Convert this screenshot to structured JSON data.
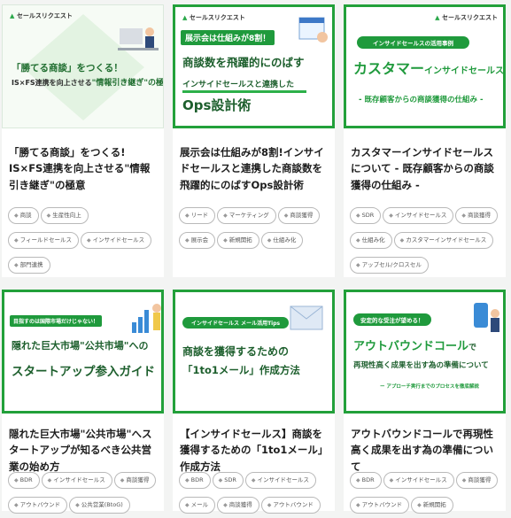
{
  "brand": "セールスリクエスト",
  "cards": [
    {
      "thumb": {
        "line1": "「勝てる商談」をつくる！",
        "line2": "IS×FS連携を向上させる",
        "line3": "\"情報引き継ぎ\"の極意"
      },
      "title": "「勝てる商談」をつくる! IS×FS連携を向上させる\"情報引き継ぎ\"の極意",
      "tags": [
        "商談",
        "生産性向上",
        "フィールドセールス",
        "インサイドセールス",
        "部門連携"
      ]
    },
    {
      "thumb": {
        "pill": "展示会は仕組みが8割！",
        "line1": "商談数を飛躍的にのばす",
        "line2": "インサイドセールスと連携した",
        "line3": "Ops設計術"
      },
      "title": "展示会は仕組みが8割!インサイドセールスと連携した商談数を飛躍的にのばすOps設計術",
      "tags": [
        "リード",
        "マーケティング",
        "商談獲得",
        "展示会",
        "新規開拓",
        "仕組み化"
      ]
    },
    {
      "thumb": {
        "pill": "インサイドセールスの活用事例",
        "line1": "カスタマー",
        "line1b": "インサイドセールス",
        "line2": "- 既存顧客からの商談獲得の仕組み -"
      },
      "title": "カスタマーインサイドセールスについて - 既存顧客からの商談獲得の仕組み -",
      "tags": [
        "SDR",
        "インサイドセールス",
        "商談獲得",
        "仕組み化",
        "カスタマーインサイドセールス",
        "アップセル/クロスセル"
      ]
    },
    {
      "thumb": {
        "pill": "目指すのは国際市場だけじゃない！",
        "line1": "隠れた巨大市場\"公共市場\"への",
        "line2": "スタートアップ参入ガイド"
      },
      "title": "隠れた巨大市場\"公共市場\"へスタートアップが知るべき公共営業の始め方",
      "tags": [
        "BDR",
        "インサイドセールス",
        "商談獲得",
        "アウトバウンド",
        "公共営業(BtoG)"
      ]
    },
    {
      "thumb": {
        "pill": "インサイドセールス メール活用Tips",
        "line1": "商談を獲得するための",
        "line2": "「1to1メール」作成方法"
      },
      "title": "【インサイドセールス】商談を獲得するための「1to1メール」作成方法",
      "tags": [
        "BDR",
        "SDR",
        "インサイドセールス",
        "メール",
        "商談獲得",
        "アウトバウンド"
      ]
    },
    {
      "thumb": {
        "pill": "安定的な受注が望める！",
        "line1": "アウトバウンドコール",
        "line1b": "で",
        "line2": "再現性高く成果を出す為の準備について",
        "line3": "ー アプローチ実行までのプロセスを徹底解説"
      },
      "title": "アウトバウンドコールで再現性高く成果を出す為の準備について",
      "tags": [
        "BDR",
        "インサイドセールス",
        "商談獲得",
        "アウトバウンド",
        "新規開拓"
      ]
    }
  ]
}
